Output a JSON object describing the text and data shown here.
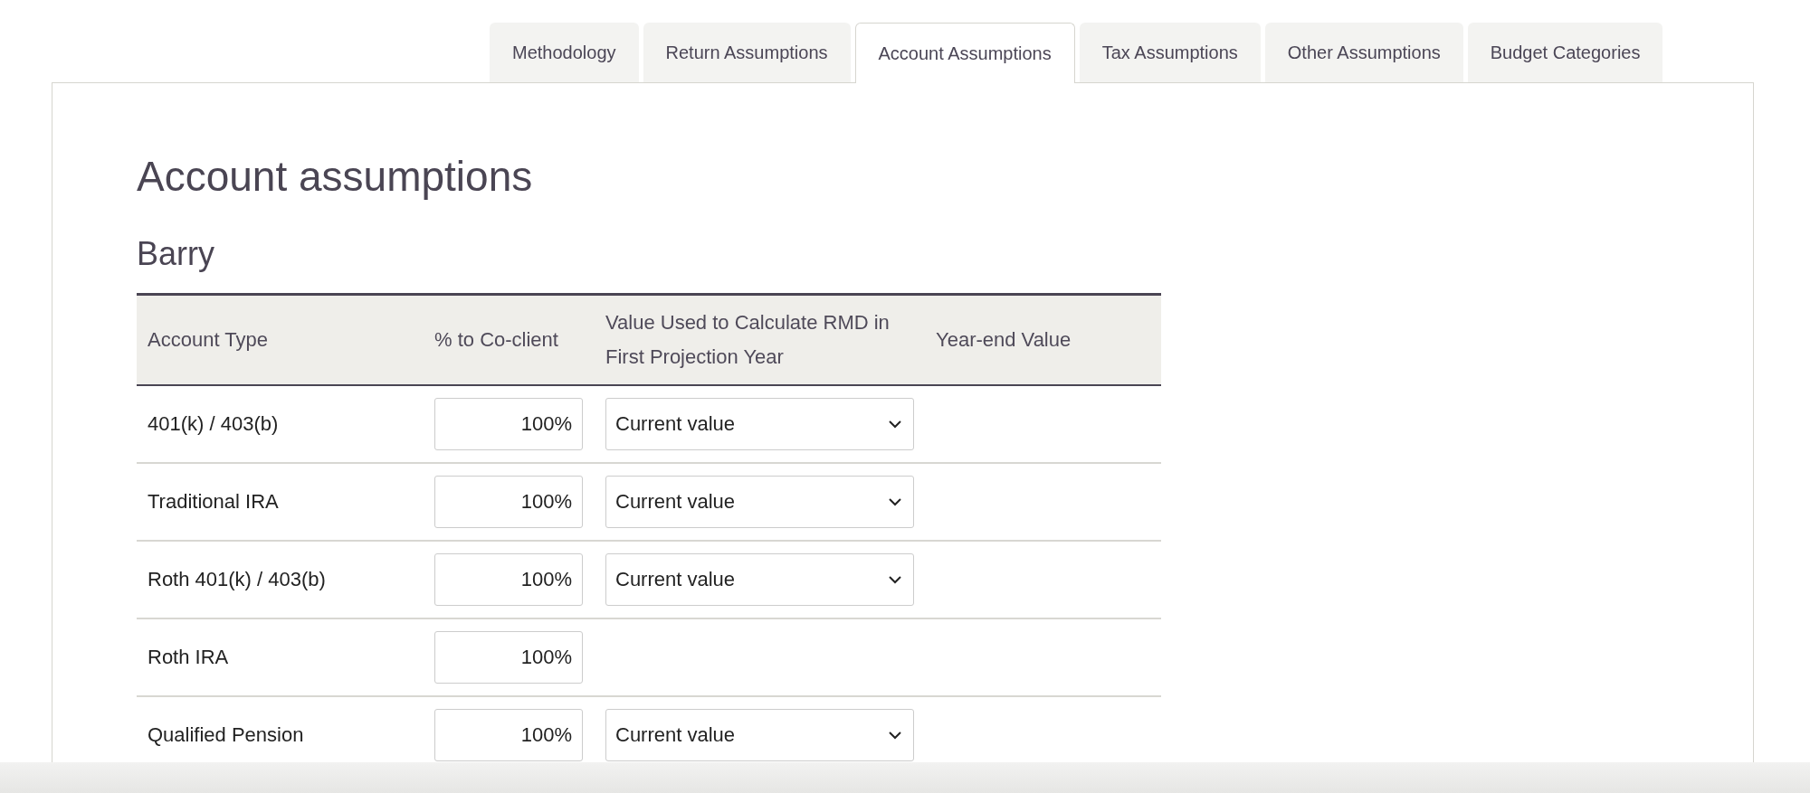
{
  "tabs": [
    {
      "label": "Methodology",
      "selected": false
    },
    {
      "label": "Return Assumptions",
      "selected": false
    },
    {
      "label": "Account Assumptions",
      "selected": true
    },
    {
      "label": "Tax Assumptions",
      "selected": false
    },
    {
      "label": "Other Assumptions",
      "selected": false
    },
    {
      "label": "Budget Categories",
      "selected": false
    }
  ],
  "page_title": "Account assumptions",
  "section_title": "Barry",
  "table": {
    "columns": [
      "Account Type",
      "% to Co-client",
      "Value Used to Calculate RMD in First Projection Year",
      "Year-end Value"
    ],
    "rows": [
      {
        "account_type": "401(k) / 403(b)",
        "percent_to_co_client": "100%",
        "rmd_value": "Current value"
      },
      {
        "account_type": "Traditional IRA",
        "percent_to_co_client": "100%",
        "rmd_value": "Current value"
      },
      {
        "account_type": "Roth 401(k) / 403(b)",
        "percent_to_co_client": "100%",
        "rmd_value": "Current value"
      },
      {
        "account_type": "Roth IRA",
        "percent_to_co_client": "100%"
      },
      {
        "account_type": "Qualified Pension",
        "percent_to_co_client": "100%",
        "rmd_value": "Current value"
      }
    ]
  }
}
